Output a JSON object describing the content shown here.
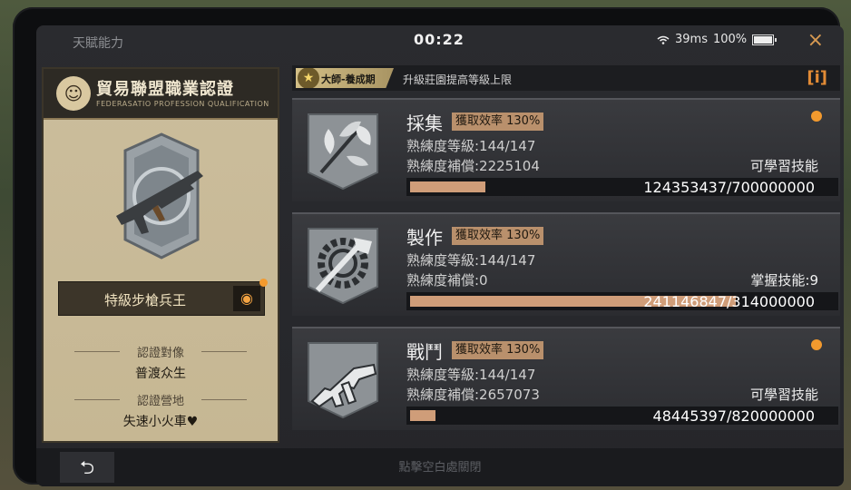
{
  "topbar": {
    "title": "天賦能力",
    "clock": "00:22",
    "ping": "39ms",
    "battery": "100%",
    "close_icon": "×"
  },
  "card": {
    "title": "貿易聯盟職業認證",
    "subtitle": "FEDERASATIO PROFESSION QUALIFICATION",
    "selected_title": "特級步槍兵王",
    "target_label": "認證對像",
    "target_value": "普渡众生",
    "base_label": "認證營地",
    "base_value": "失速小火車♥"
  },
  "rank": {
    "badge": "大師-養成期",
    "description": "升級莊園提高等級上限",
    "info_icon": "[i]"
  },
  "skills": [
    {
      "name": "採集",
      "efficiency": "獲取效率 130%",
      "level": "熟練度等級:144/147",
      "compensation": "熟練度補償:2225104",
      "right_label": "可學習技能",
      "progress_text": "124353437/700000000",
      "progress": 0.178,
      "icon": "leaf-icon",
      "has_dot": true
    },
    {
      "name": "製作",
      "efficiency": "獲取效率 130%",
      "level": "熟練度等級:144/147",
      "compensation": "熟練度補償:0",
      "right_label": "掌握技能:9",
      "progress_text": "241146847/314000000",
      "progress": 0.768,
      "icon": "gear-hammer-icon",
      "has_dot": false
    },
    {
      "name": "戰鬥",
      "efficiency": "獲取效率 130%",
      "level": "熟練度等級:144/147",
      "compensation": "熟練度補償:2657073",
      "right_label": "可學習技能",
      "progress_text": "48445397/820000000",
      "progress": 0.059,
      "icon": "smg-icon",
      "has_dot": true
    }
  ],
  "bottom": {
    "back_icon": "⮌",
    "hint": "點擊空白處關閉"
  }
}
